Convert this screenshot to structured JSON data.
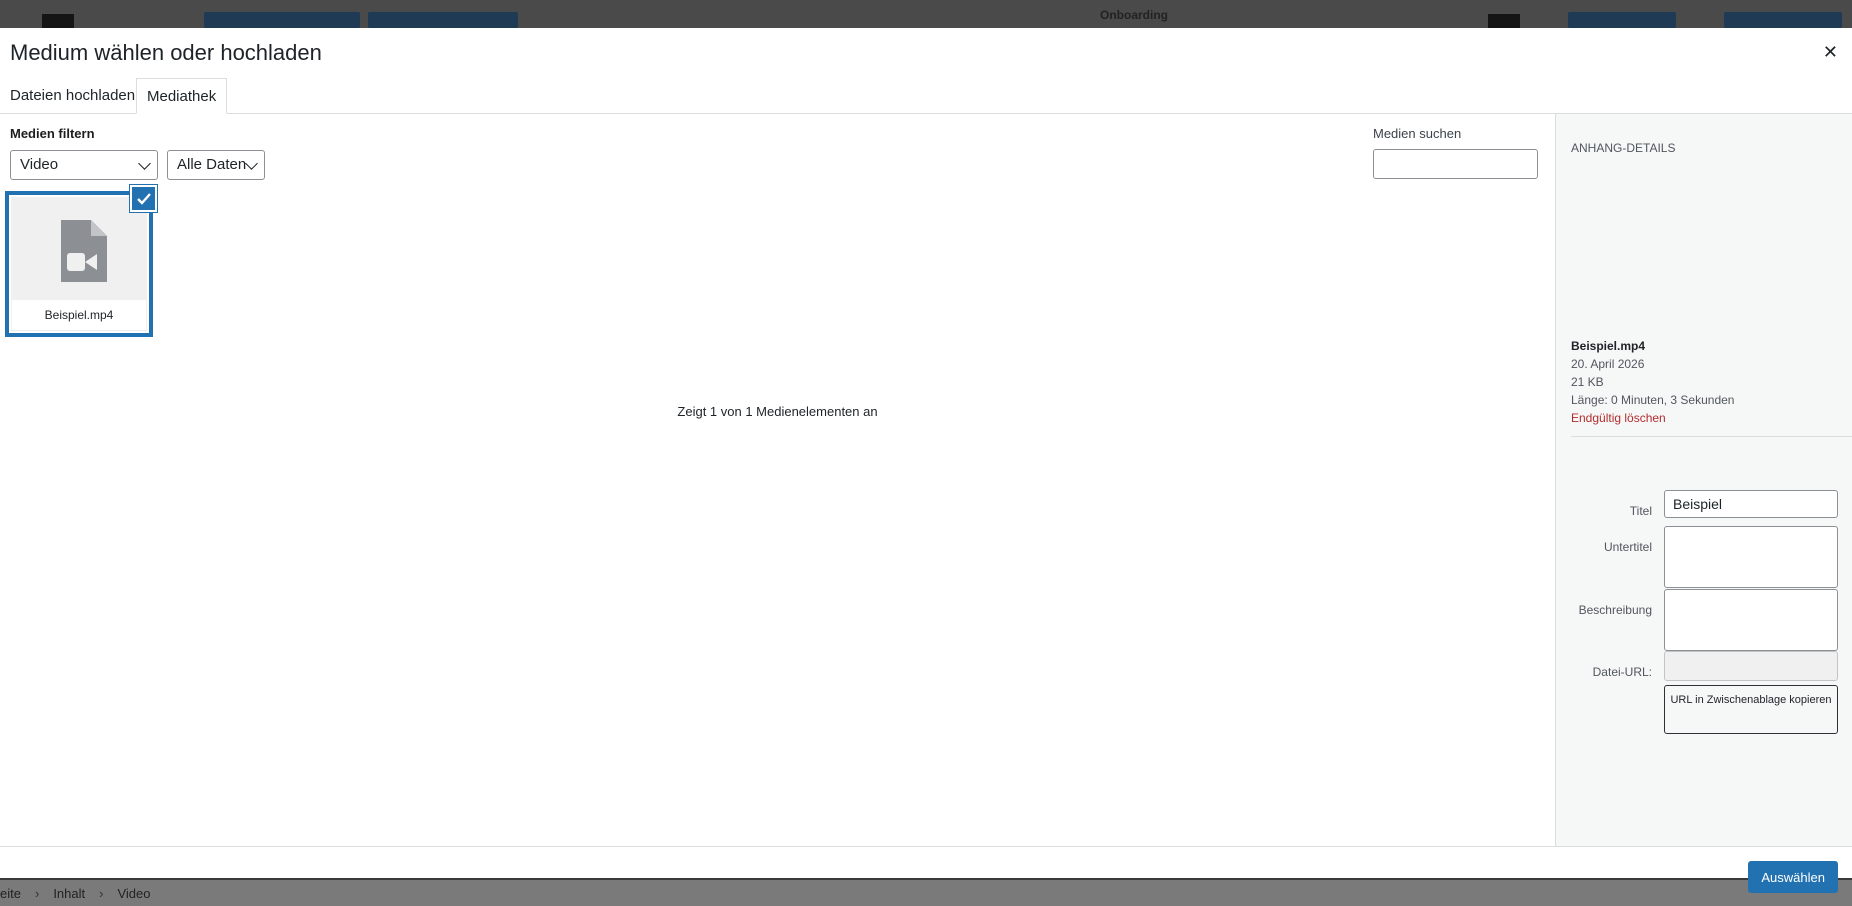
{
  "background": {
    "onboarding_label": "Onboarding",
    "breadcrumb": [
      "eite",
      "Inhalt",
      "Video"
    ]
  },
  "modal": {
    "title": "Medium wählen oder hochladen",
    "close_icon": "close-icon",
    "tabs": [
      {
        "label": "Dateien hochladen",
        "active": false
      },
      {
        "label": "Mediathek",
        "active": true
      }
    ]
  },
  "filters": {
    "label": "Medien filtern",
    "type_select": "Video",
    "date_select": "Alle Daten",
    "search_label": "Medien suchen",
    "search_value": ""
  },
  "media_items": [
    {
      "filename": "Beispiel.mp4",
      "icon": "video-file-icon",
      "selected": true
    }
  ],
  "count_text": "Zeigt 1 von 1 Medienelementen an",
  "details": {
    "heading": "Anhang-Details",
    "filename": "Beispiel.mp4",
    "date": "20. April 2026",
    "size": "21 KB",
    "length": "Länge: 0 Minuten, 3 Sekunden",
    "delete_link": "Endgültig löschen",
    "fields": {
      "title_label": "Titel",
      "title_value": "Beispiel",
      "caption_label": "Untertitel",
      "description_label": "Beschreibung",
      "url_label": "Datei-URL:",
      "url_value": ""
    },
    "copy_button": "URL in Zwischenablage kopieren"
  },
  "footer": {
    "select_button": "Auswählen"
  },
  "colors": {
    "accent": "#2271b1",
    "danger": "#b32d2e"
  }
}
